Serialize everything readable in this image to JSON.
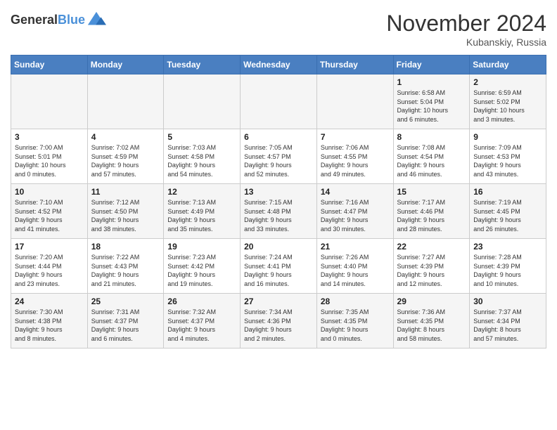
{
  "header": {
    "logo_line1": "General",
    "logo_line2": "Blue",
    "month": "November 2024",
    "location": "Kubanskiy, Russia"
  },
  "weekdays": [
    "Sunday",
    "Monday",
    "Tuesday",
    "Wednesday",
    "Thursday",
    "Friday",
    "Saturday"
  ],
  "weeks": [
    [
      {
        "day": "",
        "info": ""
      },
      {
        "day": "",
        "info": ""
      },
      {
        "day": "",
        "info": ""
      },
      {
        "day": "",
        "info": ""
      },
      {
        "day": "",
        "info": ""
      },
      {
        "day": "1",
        "info": "Sunrise: 6:58 AM\nSunset: 5:04 PM\nDaylight: 10 hours\nand 6 minutes."
      },
      {
        "day": "2",
        "info": "Sunrise: 6:59 AM\nSunset: 5:02 PM\nDaylight: 10 hours\nand 3 minutes."
      }
    ],
    [
      {
        "day": "3",
        "info": "Sunrise: 7:00 AM\nSunset: 5:01 PM\nDaylight: 10 hours\nand 0 minutes."
      },
      {
        "day": "4",
        "info": "Sunrise: 7:02 AM\nSunset: 4:59 PM\nDaylight: 9 hours\nand 57 minutes."
      },
      {
        "day": "5",
        "info": "Sunrise: 7:03 AM\nSunset: 4:58 PM\nDaylight: 9 hours\nand 54 minutes."
      },
      {
        "day": "6",
        "info": "Sunrise: 7:05 AM\nSunset: 4:57 PM\nDaylight: 9 hours\nand 52 minutes."
      },
      {
        "day": "7",
        "info": "Sunrise: 7:06 AM\nSunset: 4:55 PM\nDaylight: 9 hours\nand 49 minutes."
      },
      {
        "day": "8",
        "info": "Sunrise: 7:08 AM\nSunset: 4:54 PM\nDaylight: 9 hours\nand 46 minutes."
      },
      {
        "day": "9",
        "info": "Sunrise: 7:09 AM\nSunset: 4:53 PM\nDaylight: 9 hours\nand 43 minutes."
      }
    ],
    [
      {
        "day": "10",
        "info": "Sunrise: 7:10 AM\nSunset: 4:52 PM\nDaylight: 9 hours\nand 41 minutes."
      },
      {
        "day": "11",
        "info": "Sunrise: 7:12 AM\nSunset: 4:50 PM\nDaylight: 9 hours\nand 38 minutes."
      },
      {
        "day": "12",
        "info": "Sunrise: 7:13 AM\nSunset: 4:49 PM\nDaylight: 9 hours\nand 35 minutes."
      },
      {
        "day": "13",
        "info": "Sunrise: 7:15 AM\nSunset: 4:48 PM\nDaylight: 9 hours\nand 33 minutes."
      },
      {
        "day": "14",
        "info": "Sunrise: 7:16 AM\nSunset: 4:47 PM\nDaylight: 9 hours\nand 30 minutes."
      },
      {
        "day": "15",
        "info": "Sunrise: 7:17 AM\nSunset: 4:46 PM\nDaylight: 9 hours\nand 28 minutes."
      },
      {
        "day": "16",
        "info": "Sunrise: 7:19 AM\nSunset: 4:45 PM\nDaylight: 9 hours\nand 26 minutes."
      }
    ],
    [
      {
        "day": "17",
        "info": "Sunrise: 7:20 AM\nSunset: 4:44 PM\nDaylight: 9 hours\nand 23 minutes."
      },
      {
        "day": "18",
        "info": "Sunrise: 7:22 AM\nSunset: 4:43 PM\nDaylight: 9 hours\nand 21 minutes."
      },
      {
        "day": "19",
        "info": "Sunrise: 7:23 AM\nSunset: 4:42 PM\nDaylight: 9 hours\nand 19 minutes."
      },
      {
        "day": "20",
        "info": "Sunrise: 7:24 AM\nSunset: 4:41 PM\nDaylight: 9 hours\nand 16 minutes."
      },
      {
        "day": "21",
        "info": "Sunrise: 7:26 AM\nSunset: 4:40 PM\nDaylight: 9 hours\nand 14 minutes."
      },
      {
        "day": "22",
        "info": "Sunrise: 7:27 AM\nSunset: 4:39 PM\nDaylight: 9 hours\nand 12 minutes."
      },
      {
        "day": "23",
        "info": "Sunrise: 7:28 AM\nSunset: 4:39 PM\nDaylight: 9 hours\nand 10 minutes."
      }
    ],
    [
      {
        "day": "24",
        "info": "Sunrise: 7:30 AM\nSunset: 4:38 PM\nDaylight: 9 hours\nand 8 minutes."
      },
      {
        "day": "25",
        "info": "Sunrise: 7:31 AM\nSunset: 4:37 PM\nDaylight: 9 hours\nand 6 minutes."
      },
      {
        "day": "26",
        "info": "Sunrise: 7:32 AM\nSunset: 4:37 PM\nDaylight: 9 hours\nand 4 minutes."
      },
      {
        "day": "27",
        "info": "Sunrise: 7:34 AM\nSunset: 4:36 PM\nDaylight: 9 hours\nand 2 minutes."
      },
      {
        "day": "28",
        "info": "Sunrise: 7:35 AM\nSunset: 4:35 PM\nDaylight: 9 hours\nand 0 minutes."
      },
      {
        "day": "29",
        "info": "Sunrise: 7:36 AM\nSunset: 4:35 PM\nDaylight: 8 hours\nand 58 minutes."
      },
      {
        "day": "30",
        "info": "Sunrise: 7:37 AM\nSunset: 4:34 PM\nDaylight: 8 hours\nand 57 minutes."
      }
    ]
  ]
}
